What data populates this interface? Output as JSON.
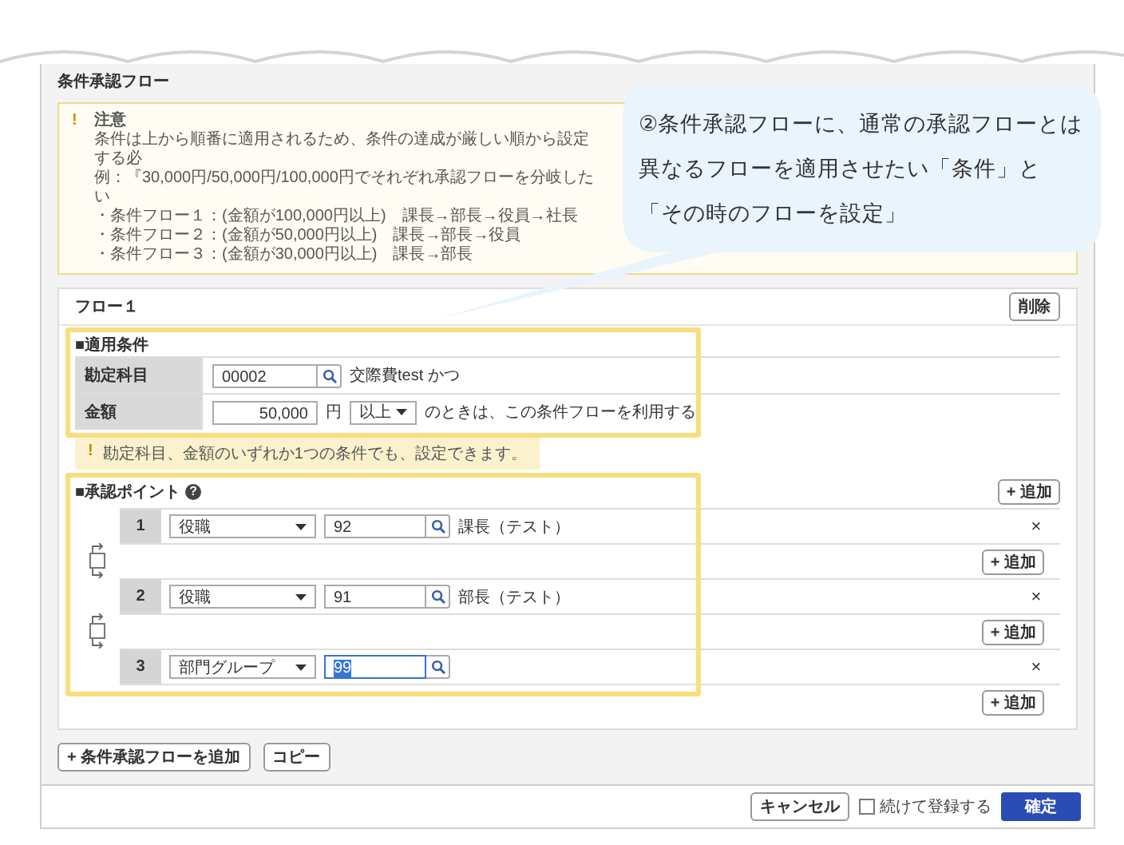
{
  "page_title": "条件承認フロー",
  "notice": {
    "icon": "!",
    "title": "注意",
    "lines": [
      "条件は上から順番に適用されるため、条件の達成が厳しい順から設定する必",
      "例：『30,000円/50,000円/100,000円でそれぞれ承認フローを分岐したい"
    ],
    "bullets": [
      "・条件フロー１：(金額が100,000円以上)　課長→部長→役員→社長",
      "・条件フロー２：(金額が50,000円以上)　課長→部長→役員",
      "・条件フロー３：(金額が30,000円以上)　課長→部長"
    ]
  },
  "callout": {
    "lines": [
      "②条件承認フローに、通常の承認フローとは",
      "異なるフローを適用させたい「条件」と",
      "「その時のフローを設定」"
    ]
  },
  "flows": [
    {
      "title": "フロー１",
      "delete_label": "削除",
      "conditions": {
        "heading": "■適用条件",
        "rows": [
          {
            "kind": "code",
            "label": "勘定科目",
            "value": "00002",
            "suffix": "交際費test かつ"
          },
          {
            "kind": "amount",
            "label": "金額",
            "value": "50,000",
            "unit": "円",
            "operator": "以上",
            "suffix": "のときは、この条件フローを利用する"
          }
        ],
        "hint_icon": "!",
        "hint": "勘定科目、金額のいずれか1つの条件でも、設定できます。"
      },
      "approval": {
        "heading": "■承認ポイント",
        "help_icon": "?",
        "add_label": "+ 追加",
        "steps": [
          {
            "number": "1",
            "type": "役職",
            "code": "92",
            "name": "課長（テスト）",
            "focused": false,
            "remove_label": "×",
            "add_label": "+ 追加",
            "branch_checked": false
          },
          {
            "number": "2",
            "type": "役職",
            "code": "91",
            "name": "部長（テスト）",
            "focused": false,
            "remove_label": "×",
            "add_label": "+ 追加",
            "branch_checked": false
          },
          {
            "number": "3",
            "type": "部門グループ",
            "code": "99",
            "focused": true,
            "remove_label": "×",
            "add_label": "+ 追加"
          }
        ]
      }
    }
  ],
  "actions": {
    "add_flow": "+ 条件承認フローを追加",
    "copy": "コピー"
  },
  "footer": {
    "cancel": "キャンセル",
    "continue_label": "続けて登録する",
    "continue_checked": false,
    "confirm": "確定"
  }
}
